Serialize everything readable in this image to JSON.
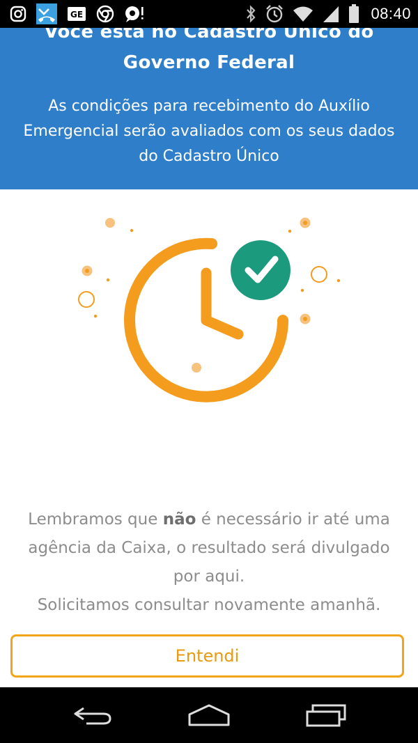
{
  "status_bar": {
    "time": "08:40",
    "left_icons": [
      "instagram-icon",
      "missed-call-icon",
      "ge-app-icon",
      "chrome-icon",
      "chat-alert-icon"
    ],
    "right_icons": [
      "bluetooth-icon",
      "alarm-icon",
      "wifi-icon",
      "signal-icon",
      "battery-icon"
    ],
    "ge_label": "GE"
  },
  "header": {
    "title_line1": "Você está no Cadastro Único do",
    "title_line2": "Governo Federal",
    "subtitle": "As condições para recebimento do Auxílio Emergencial serão avaliados com os seus dados do Cadastro Único",
    "background_color": "#2f7ec9"
  },
  "illustration": {
    "icon": "clock-check-icon",
    "clock_color": "#f49c1e",
    "check_color": "#1b9a7e"
  },
  "message": {
    "line1_before": "Lembramos que ",
    "line1_bold": "não",
    "line1_after": " é necessário ir até uma",
    "line2": "agência da Caixa, o resultado será divulgado",
    "line3": "por aqui.",
    "line4": "Solicitamos consultar novamente amanhã."
  },
  "button": {
    "label": "Entendi",
    "accent_color": "#f2a516"
  },
  "nav_bar": {
    "icons": [
      "back-icon",
      "home-icon",
      "recent-apps-icon"
    ]
  }
}
